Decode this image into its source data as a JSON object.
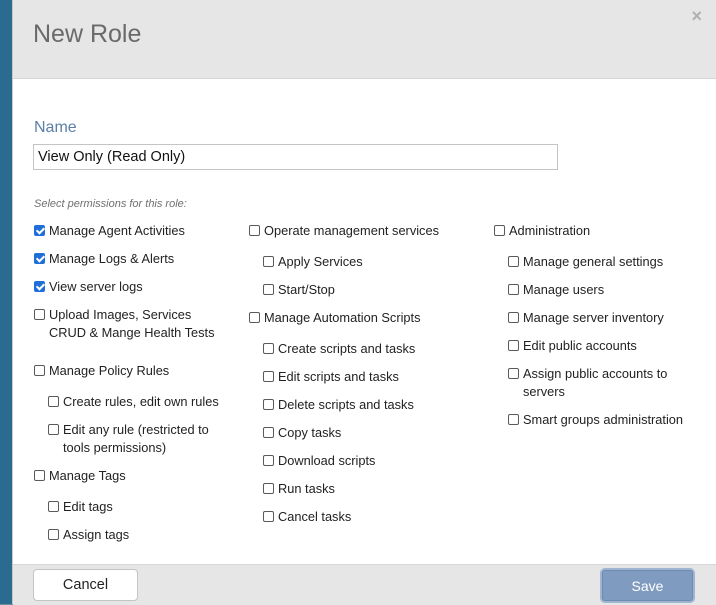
{
  "dialog": {
    "title": "New Role",
    "close_glyph": "×",
    "name_label": "Name",
    "name_value": "View Only (Read Only)",
    "hint": "Select permissions for this role:",
    "cancel_label": "Cancel",
    "save_label": "Save"
  },
  "permissions": {
    "manage_agent_activities": {
      "label": "Manage Agent Activities",
      "checked": true
    },
    "manage_logs_alerts": {
      "label": "Manage Logs & Alerts",
      "checked": true
    },
    "view_server_logs": {
      "label": "View server logs",
      "checked": true
    },
    "upload_images": {
      "label": "Upload Images, Services CRUD & Mange Health Tests",
      "checked": false
    },
    "manage_policy_rules": {
      "label": "Manage Policy Rules",
      "checked": false
    },
    "create_rules": {
      "label": "Create rules, edit own rules",
      "checked": false
    },
    "edit_any_rule": {
      "label": "Edit any rule (restricted to tools permissions)",
      "checked": false
    },
    "manage_tags": {
      "label": "Manage Tags",
      "checked": false
    },
    "edit_tags": {
      "label": "Edit tags",
      "checked": false
    },
    "assign_tags": {
      "label": "Assign tags",
      "checked": false
    },
    "operate_mgmt_services": {
      "label": "Operate management services",
      "checked": false
    },
    "apply_services": {
      "label": "Apply Services",
      "checked": false
    },
    "start_stop": {
      "label": "Start/Stop",
      "checked": false
    },
    "manage_automation_scripts": {
      "label": "Manage Automation Scripts",
      "checked": false
    },
    "create_scripts": {
      "label": "Create scripts and tasks",
      "checked": false
    },
    "edit_scripts": {
      "label": "Edit scripts and tasks",
      "checked": false
    },
    "delete_scripts": {
      "label": "Delete scripts and tasks",
      "checked": false
    },
    "copy_tasks": {
      "label": "Copy tasks",
      "checked": false
    },
    "download_scripts": {
      "label": "Download scripts",
      "checked": false
    },
    "run_tasks": {
      "label": "Run tasks",
      "checked": false
    },
    "cancel_tasks": {
      "label": "Cancel tasks",
      "checked": false
    },
    "administration": {
      "label": "Administration",
      "checked": false
    },
    "manage_general_settings": {
      "label": "Manage general settings",
      "checked": false
    },
    "manage_users": {
      "label": "Manage users",
      "checked": false
    },
    "manage_server_inventory": {
      "label": "Manage server inventory",
      "checked": false
    },
    "edit_public_accounts": {
      "label": "Edit public accounts",
      "checked": false
    },
    "assign_public_accounts": {
      "label": "Assign public accounts to servers",
      "checked": false
    },
    "smart_groups_admin": {
      "label": "Smart groups administration",
      "checked": false
    }
  },
  "colors": {
    "checked": "#1f6fd8",
    "save_button": "#7f9cc0",
    "name_label": "#5c7fa6"
  }
}
